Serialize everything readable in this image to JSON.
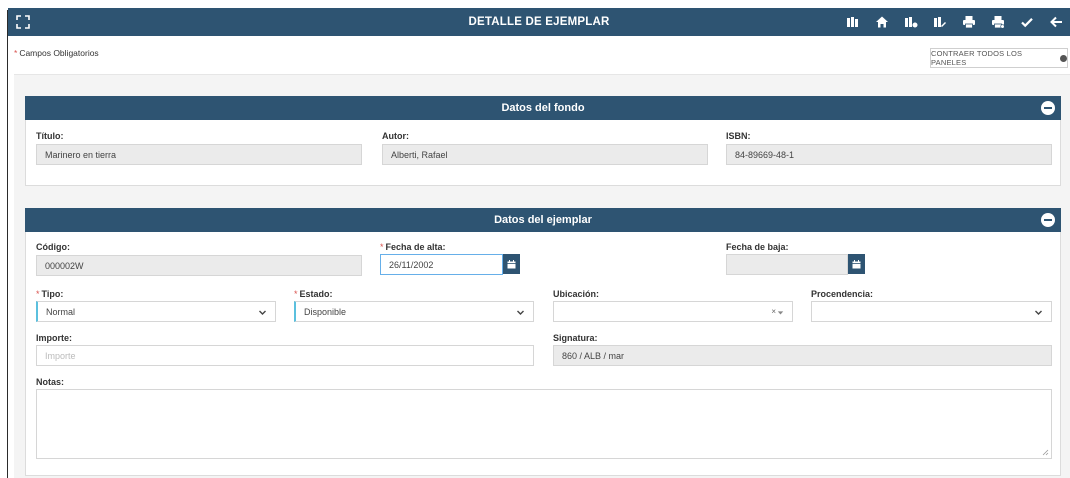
{
  "header": {
    "title": "DETALLE DE EJEMPLAR",
    "icons": [
      "expand-icon",
      "books-icon",
      "home-icon",
      "books-settings-icon",
      "books-edit-icon",
      "print-icon",
      "print-settings-icon",
      "check-icon",
      "back-arrow-icon"
    ]
  },
  "required_note": {
    "asterisk": "*",
    "text": "Campos Obligatorios"
  },
  "collapse_all_label": "CONTRAER TODOS LOS PANELES",
  "panels": {
    "fondo": {
      "title": "Datos del fondo",
      "titulo": {
        "label": "Título:",
        "value": "Marinero en tierra"
      },
      "autor": {
        "label": "Autor:",
        "value": "Alberti, Rafael"
      },
      "isbn": {
        "label": "ISBN:",
        "value": "84-89669-48-1"
      }
    },
    "ejemplar": {
      "title": "Datos del ejemplar",
      "codigo": {
        "label": "Código:",
        "value": "000002W"
      },
      "fecha_alta": {
        "label": "Fecha de alta:",
        "value": "26/11/2002",
        "required": "*"
      },
      "fecha_baja": {
        "label": "Fecha de baja:",
        "value": ""
      },
      "tipo": {
        "label": "Tipo:",
        "value": "Normal",
        "required": "*"
      },
      "estado": {
        "label": "Estado:",
        "value": "Disponible",
        "required": "*"
      },
      "ubicacion": {
        "label": "Ubicación:",
        "value": "",
        "clear": "×"
      },
      "procedencia": {
        "label": "Procendencia:",
        "value": ""
      },
      "importe": {
        "label": "Importe:",
        "placeholder": "Importe"
      },
      "signatura": {
        "label": "Signatura:",
        "value": "860 / ALB / mar"
      },
      "notas": {
        "label": "Notas:",
        "value": ""
      }
    }
  },
  "colors": {
    "header_bg": "#2e5472",
    "required": "#d9534f",
    "focus": "#66afe9"
  }
}
